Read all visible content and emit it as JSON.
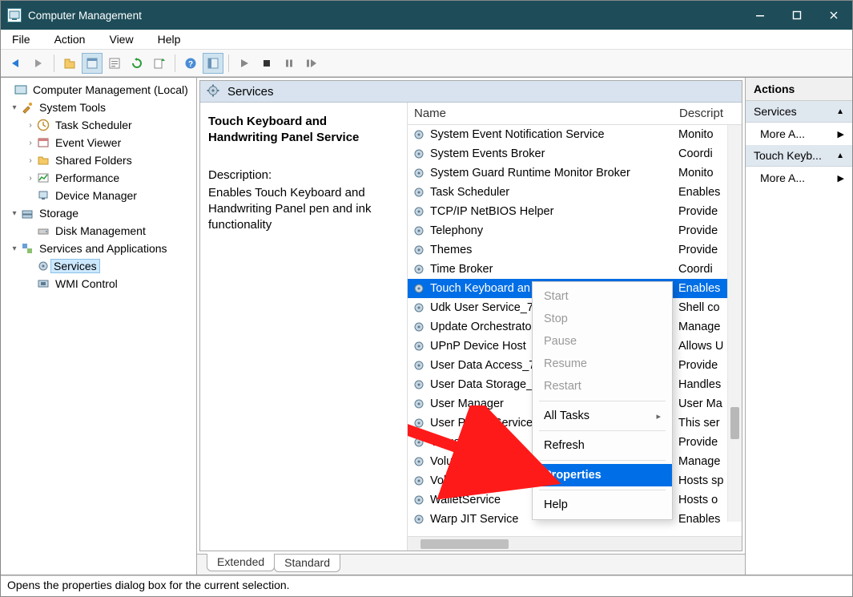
{
  "window": {
    "title": "Computer Management"
  },
  "menu": [
    "File",
    "Action",
    "View",
    "Help"
  ],
  "tree": {
    "root": "Computer Management (Local)",
    "system_tools": "System Tools",
    "system_tools_children": [
      "Task Scheduler",
      "Event Viewer",
      "Shared Folders",
      "Performance",
      "Device Manager"
    ],
    "storage": "Storage",
    "storage_children": [
      "Disk Management"
    ],
    "saa": "Services and Applications",
    "saa_children": [
      "Services",
      "WMI Control"
    ]
  },
  "center": {
    "header": "Services",
    "selected_name": "Touch Keyboard and Handwriting Panel Service",
    "desc_label": "Description:",
    "desc_text": "Enables Touch Keyboard and Handwriting Panel pen and ink functionality",
    "col_name": "Name",
    "col_desc": "Descript",
    "rows": [
      {
        "name": "System Event Notification Service",
        "desc": "Monito"
      },
      {
        "name": "System Events Broker",
        "desc": "Coordi"
      },
      {
        "name": "System Guard Runtime Monitor Broker",
        "desc": "Monito"
      },
      {
        "name": "Task Scheduler",
        "desc": "Enables"
      },
      {
        "name": "TCP/IP NetBIOS Helper",
        "desc": "Provide"
      },
      {
        "name": "Telephony",
        "desc": "Provide"
      },
      {
        "name": "Themes",
        "desc": "Provide"
      },
      {
        "name": "Time Broker",
        "desc": "Coordi"
      },
      {
        "name": "Touch Keyboard and Handwriting Panel Service",
        "desc": "Enables",
        "selected": true,
        "short": "Touch Keyboard an"
      },
      {
        "name": "Udk User Service_73d30",
        "desc": "Shell co"
      },
      {
        "name": "Update Orchestrator Service",
        "desc": "Manage",
        "short": "Update Orchestrato"
      },
      {
        "name": "UPnP Device Host",
        "desc": "Allows U"
      },
      {
        "name": "User Data Access_73d30",
        "desc": "Provide",
        "short": "User Data Access_73"
      },
      {
        "name": "User Data Storage_73d30",
        "desc": "Handles",
        "short": "User Data Storage_7"
      },
      {
        "name": "User Manager",
        "desc": "User Ma"
      },
      {
        "name": "User Profile Service",
        "desc": "This ser"
      },
      {
        "name": "Virtual Disk",
        "desc": "Provide"
      },
      {
        "name": "Volume Shadow Copy",
        "desc": "Manage",
        "short": "Volume Shadow Co"
      },
      {
        "name": "Volumetric Audio Compositor",
        "desc": "Hosts sp",
        "short": "Volumetric Audio"
      },
      {
        "name": "WalletService",
        "desc": "Hosts o"
      },
      {
        "name": "Warp JIT Service",
        "desc": "Enables"
      }
    ],
    "tabs": [
      "Extended",
      "Standard"
    ]
  },
  "context_menu": {
    "items": [
      {
        "label": "Start",
        "disabled": true
      },
      {
        "label": "Stop",
        "disabled": true
      },
      {
        "label": "Pause",
        "disabled": true
      },
      {
        "label": "Resume",
        "disabled": true
      },
      {
        "label": "Restart",
        "disabled": true
      },
      {
        "sep": true
      },
      {
        "label": "All Tasks",
        "sub": true
      },
      {
        "sep": true
      },
      {
        "label": "Refresh"
      },
      {
        "sep": true
      },
      {
        "label": "Properties",
        "highlight": true
      },
      {
        "sep": true
      },
      {
        "label": "Help"
      }
    ]
  },
  "actions": {
    "header": "Actions",
    "sections": [
      "Services",
      "Touch Keyb..."
    ],
    "more": "More A..."
  },
  "status": "Opens the properties dialog box for the current selection."
}
